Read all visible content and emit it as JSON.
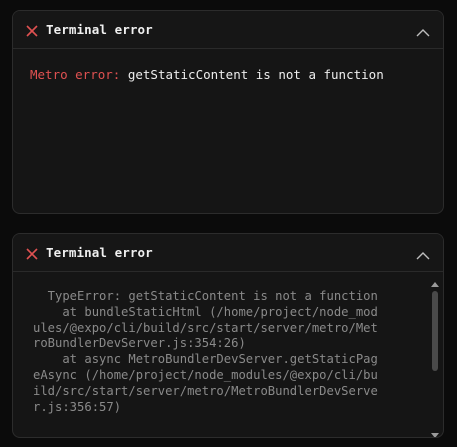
{
  "panels": [
    {
      "title": "Terminal error",
      "error_prefix": "Metro error: ",
      "error_message": "getStaticContent is not a function"
    },
    {
      "title": "Terminal error",
      "stack_trace": "  TypeError: getStaticContent is not a function\n    at bundleStaticHtml (/home/project/node_mod\nules/@expo/cli/build/src/start/server/metro/Met\nroBundlerDevServer.js:354:26)\n    at async MetroBundlerDevServer.getStaticPag\neAsync (/home/project/node_modules/@expo/cli/bu\nild/src/start/server/metro/MetroBundlerDevServe\nr.js:356:57)"
    }
  ],
  "colors": {
    "accent_error": "#e05151",
    "panel_bg": "#151515",
    "page_bg": "#0b0b0b",
    "border": "#2c2c2c"
  },
  "icons": {
    "close": "close-x-icon",
    "collapse": "chevron-up-icon",
    "scroll_up": "scroll-up-arrow-icon",
    "scroll_down": "scroll-down-arrow-icon"
  }
}
